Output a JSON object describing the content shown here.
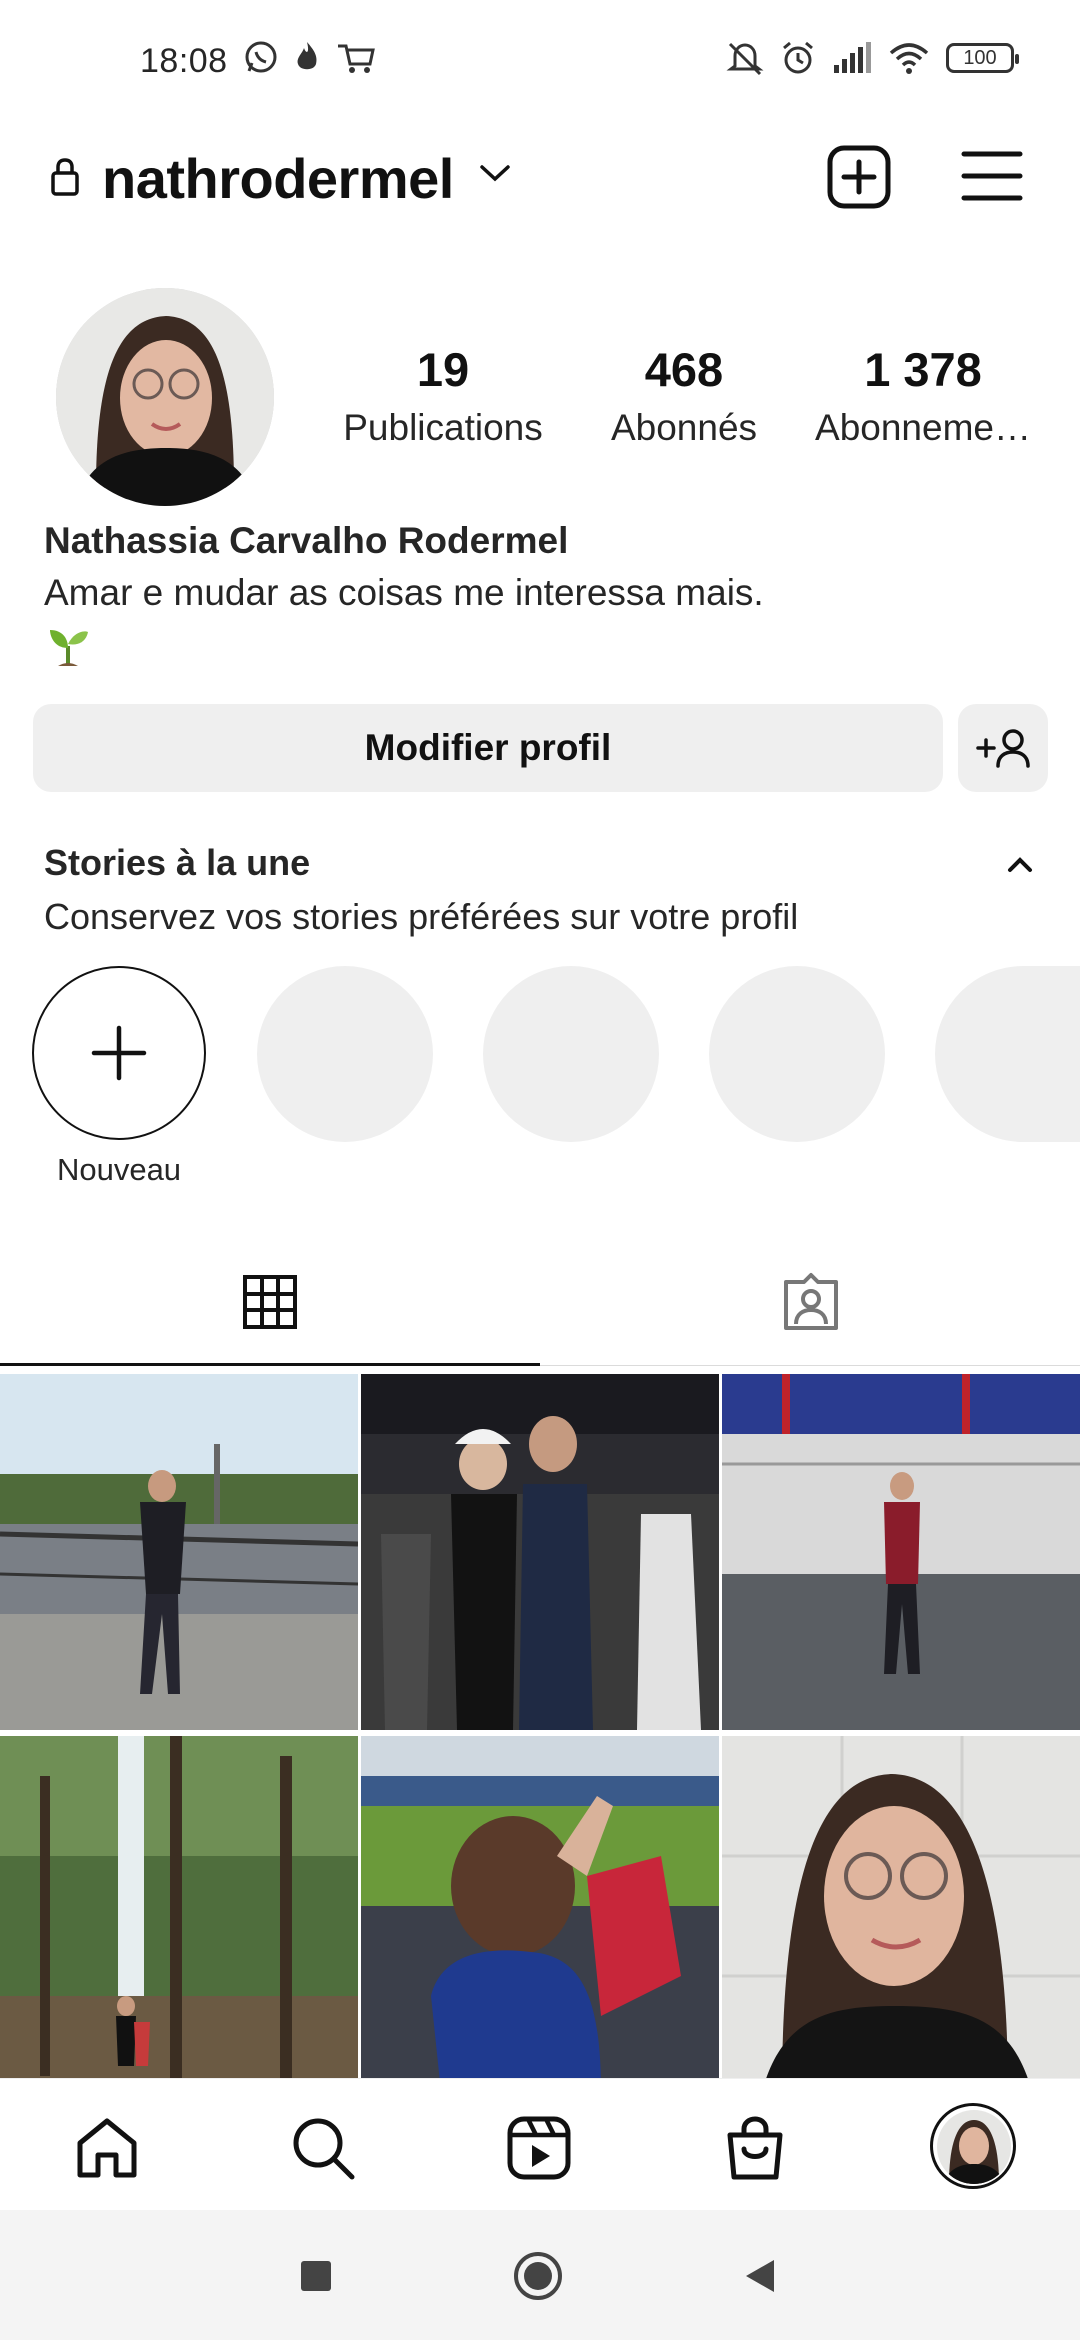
{
  "status_bar": {
    "time": "18:08",
    "battery": "100"
  },
  "header": {
    "username": "nathrodermel"
  },
  "profile": {
    "stats": [
      {
        "value": "19",
        "label": "Publications"
      },
      {
        "value": "468",
        "label": "Abonnés"
      },
      {
        "value": "1 378",
        "label": "Abonneme…"
      }
    ],
    "full_name": "Nathassia Carvalho Rodermel",
    "bio": "Amar e mudar as coisas me interessa mais."
  },
  "actions": {
    "edit_profile": "Modifier profil"
  },
  "stories": {
    "title": "Stories à la une",
    "subtitle": "Conservez vos stories préférées sur votre profil",
    "new_label": "Nouveau"
  },
  "colors": {
    "text": "#262626",
    "button_bg": "#efefef",
    "divider": "#dbdbdb"
  }
}
